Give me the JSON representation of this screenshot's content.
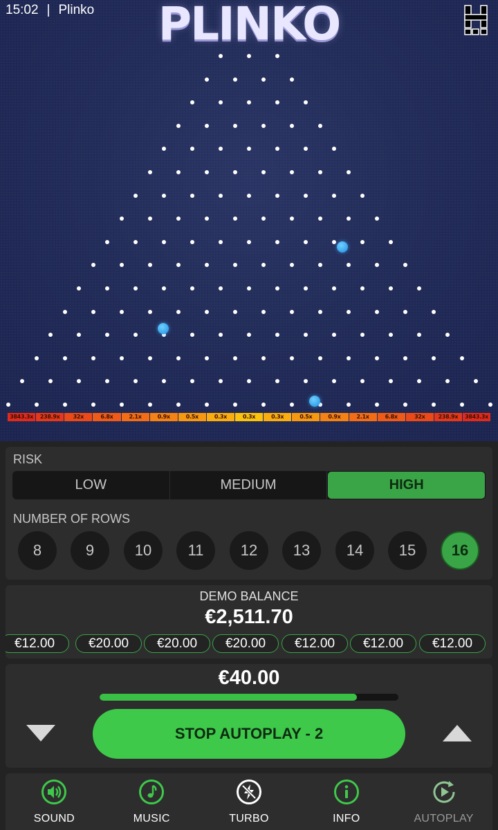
{
  "status_bar": {
    "time": "15:02",
    "app_name": "Plinko"
  },
  "game": {
    "title": "PLINKO",
    "multipliers": [
      "3843.3x",
      "238.9x",
      "32x",
      "6.8x",
      "2.1x",
      "0.9x",
      "0.5x",
      "0.3x",
      "0.3x",
      "0.3x",
      "0.5x",
      "0.9x",
      "2.1x",
      "6.8x",
      "32x",
      "238.9x",
      "3843.3x"
    ],
    "slot_colors": [
      "#e02a1e",
      "#e4381c",
      "#ea4a1a",
      "#ee5b18",
      "#f26d16",
      "#f58214",
      "#f79812",
      "#f9ad10",
      "#fbc20e",
      "#f9ad10",
      "#f79812",
      "#f58214",
      "#f26d16",
      "#ee5b18",
      "#ea4a1a",
      "#e4381c",
      "#e02a1e"
    ]
  },
  "settings": {
    "risk_label": "RISK",
    "risk_options": [
      "LOW",
      "MEDIUM",
      "HIGH"
    ],
    "risk_selected": "HIGH",
    "rows_label": "NUMBER OF ROWS",
    "rows_options": [
      "8",
      "9",
      "10",
      "11",
      "12",
      "13",
      "14",
      "15",
      "16"
    ],
    "rows_selected": "16"
  },
  "balance": {
    "label": "DEMO BALANCE",
    "value": "€2,511.70",
    "history": [
      "€12.00",
      "€20.00",
      "€20.00",
      "€20.00",
      "€12.00",
      "€12.00",
      "€12.00"
    ]
  },
  "bet": {
    "value": "€40.00",
    "progress": 0.86,
    "stop_label": "STOP AUTOPLAY - 2"
  },
  "nav": {
    "sound": "SOUND",
    "music": "MUSIC",
    "turbo": "TURBO",
    "info": "INFO",
    "autoplay": "AUTOPLAY"
  },
  "colors": {
    "accent_green": "#3ec94a",
    "board_bg": "#222c58",
    "ball": "#2a9fe8"
  },
  "icons": [
    "speaker-icon",
    "music-note-icon",
    "lightning-off-icon",
    "info-icon",
    "autoplay-icon",
    "chevron-down-icon",
    "chevron-up-icon"
  ]
}
